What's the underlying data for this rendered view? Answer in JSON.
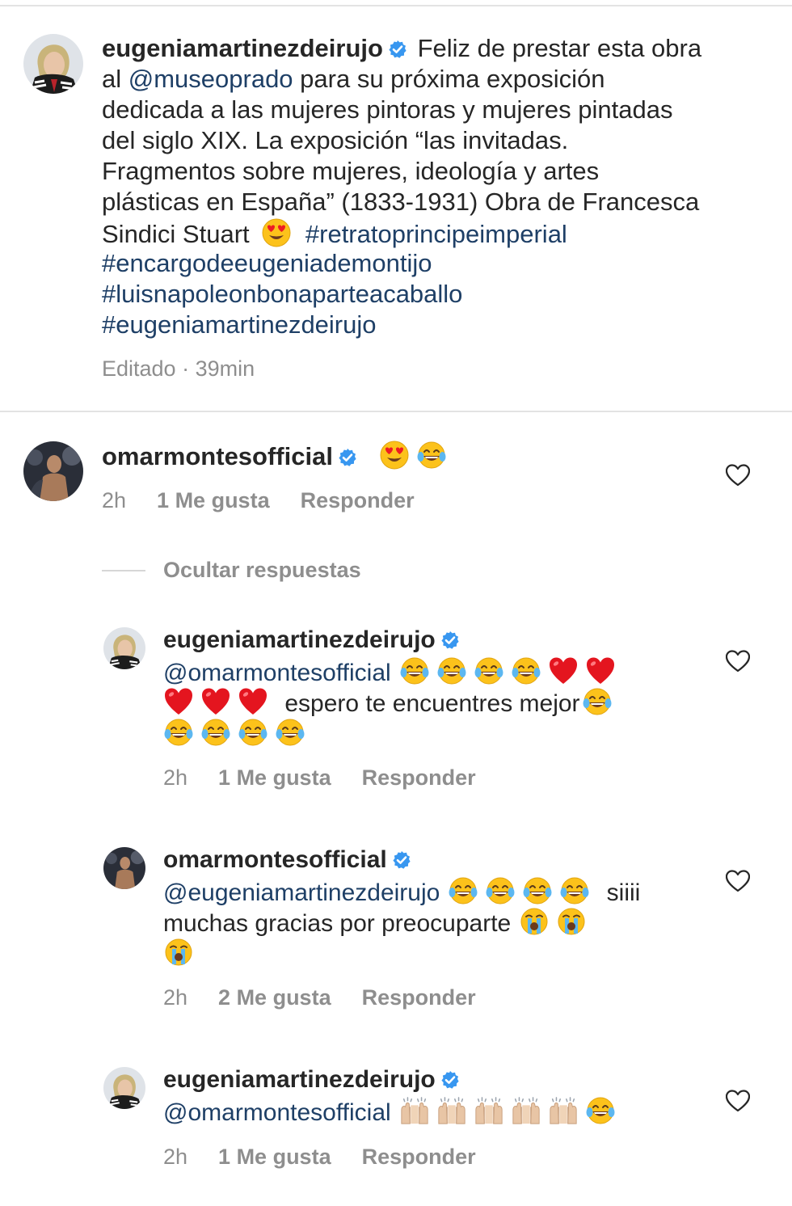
{
  "caption": {
    "username": "eugeniamartinezdeirujo",
    "lines": [
      "Feliz de prestar esta obra",
      [
        "al ",
        "@museoprado",
        " para su próxima exposición"
      ],
      "dedicada a las mujeres pintoras y mujeres pintadas",
      "del siglo XIX. La exposición “las invitadas.",
      "Fragmentos sobre mujeres, ideología y artes",
      "plásticas en España” (1833-1931) Obra de Francesca",
      "Sindici Stuart"
    ],
    "hashtags": [
      "#retratoprincipeimperial",
      "#encargodeeugeniademontijo",
      "#luisnapoleonbonaparteacaballo",
      "#eugeniamartinezdeirujo"
    ],
    "meta": "Editado · 39min"
  },
  "comment": {
    "username": "omarmontesofficial",
    "time": "2h",
    "likes": "1 Me gusta",
    "reply_label": "Responder",
    "emojis": [
      "heart-eyes",
      "laughing-tears"
    ]
  },
  "hide_replies_label": "Ocultar respuestas",
  "replies": [
    {
      "username": "eugeniamartinezdeirujo",
      "mention": "@omarmontesofficial",
      "text": "espero te encuentres mejor",
      "time": "2h",
      "likes": "1 Me gusta",
      "reply_label": "Responder"
    },
    {
      "username": "omarmontesofficial",
      "mention": "@eugeniamartinezdeirujo",
      "text_a": "siiii",
      "text_b": "muchas gracias por preocuparte",
      "time": "2h",
      "likes": "2 Me gusta",
      "reply_label": "Responder"
    },
    {
      "username": "eugeniamartinezdeirujo",
      "mention": "@omarmontesofficial",
      "time": "2h",
      "likes": "1 Me gusta",
      "reply_label": "Responder"
    }
  ],
  "icons": {
    "verified": "verified-badge-icon",
    "heart": "heart-outline-icon",
    "emoji_heart_eyes": "heart-eyes-emoji",
    "emoji_laughing": "laughing-tears-emoji",
    "emoji_red_heart": "red-heart-emoji",
    "emoji_crying": "loudly-crying-emoji",
    "emoji_raised_hands": "raised-hands-emoji"
  },
  "colors": {
    "link": "#1e3f66",
    "verified": "#3897f0",
    "meta": "#8e8e8e",
    "text": "#262626"
  }
}
